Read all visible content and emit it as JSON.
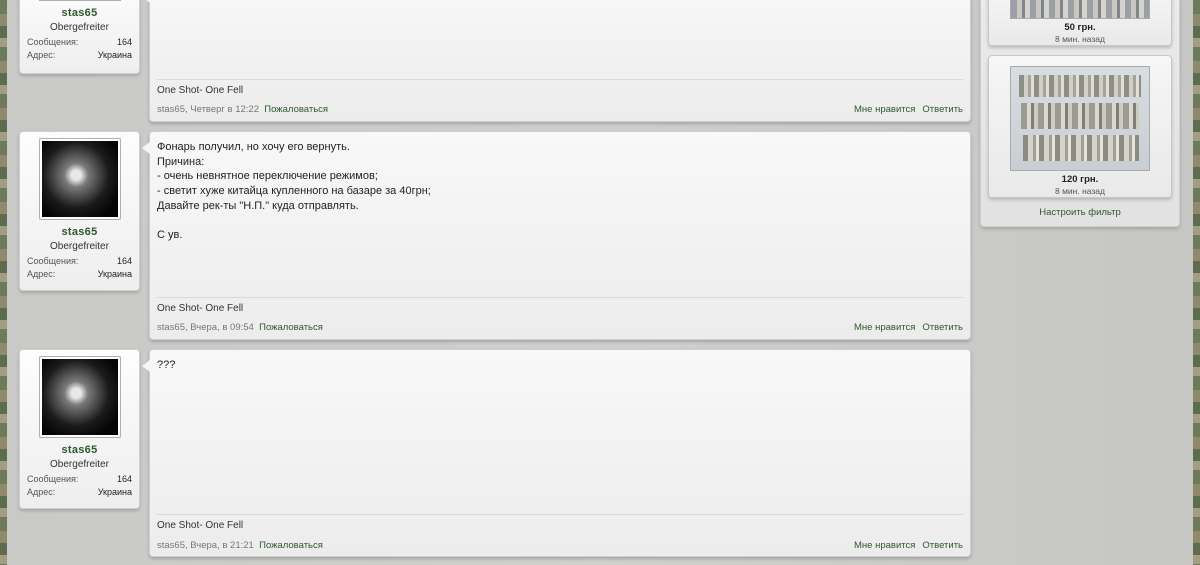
{
  "posts": [
    {
      "user": {
        "name": "stas65",
        "title": "Obergefreiter",
        "messages_label": "Сообщения:",
        "messages": "164",
        "address_label": "Адрес:",
        "address": "Украина"
      },
      "text": "",
      "signature": "One Shot- One Fell",
      "meta": "stas65, Четверг в 12:22",
      "report": "Пожаловаться",
      "like": "Мне нравится",
      "reply": "Ответить"
    },
    {
      "user": {
        "name": "stas65",
        "title": "Obergefreiter",
        "messages_label": "Сообщения:",
        "messages": "164",
        "address_label": "Адрес:",
        "address": "Украина"
      },
      "text": "Фонарь получил, но хочу его вернуть.\nПричина:\n- очень невнятное переключение режимов;\n- светит хуже китайца купленного на базаре за 40грн;\nДавайте рек-ты \"Н.П.\" куда отправлять.\n\nС ув.",
      "signature": "One Shot- One Fell",
      "meta": "stas65, Вчера, в 09:54",
      "report": "Пожаловаться",
      "like": "Мне нравится",
      "reply": "Ответить"
    },
    {
      "user": {
        "name": "stas65",
        "title": "Obergefreiter",
        "messages_label": "Сообщения:",
        "messages": "164",
        "address_label": "Адрес:",
        "address": "Украина"
      },
      "text": "???",
      "signature": "One Shot- One Fell",
      "meta": "stas65, Вчера, в 21:21",
      "report": "Пожаловаться",
      "like": "Мне нравится",
      "reply": "Ответить"
    }
  ],
  "sidebar": {
    "listings": [
      {
        "price": "50 грн.",
        "ago": "8 мин. назад"
      },
      {
        "price": "120 грн.",
        "ago": "8 мин. назад"
      }
    ],
    "filter_label": "Настроить фильтр"
  }
}
